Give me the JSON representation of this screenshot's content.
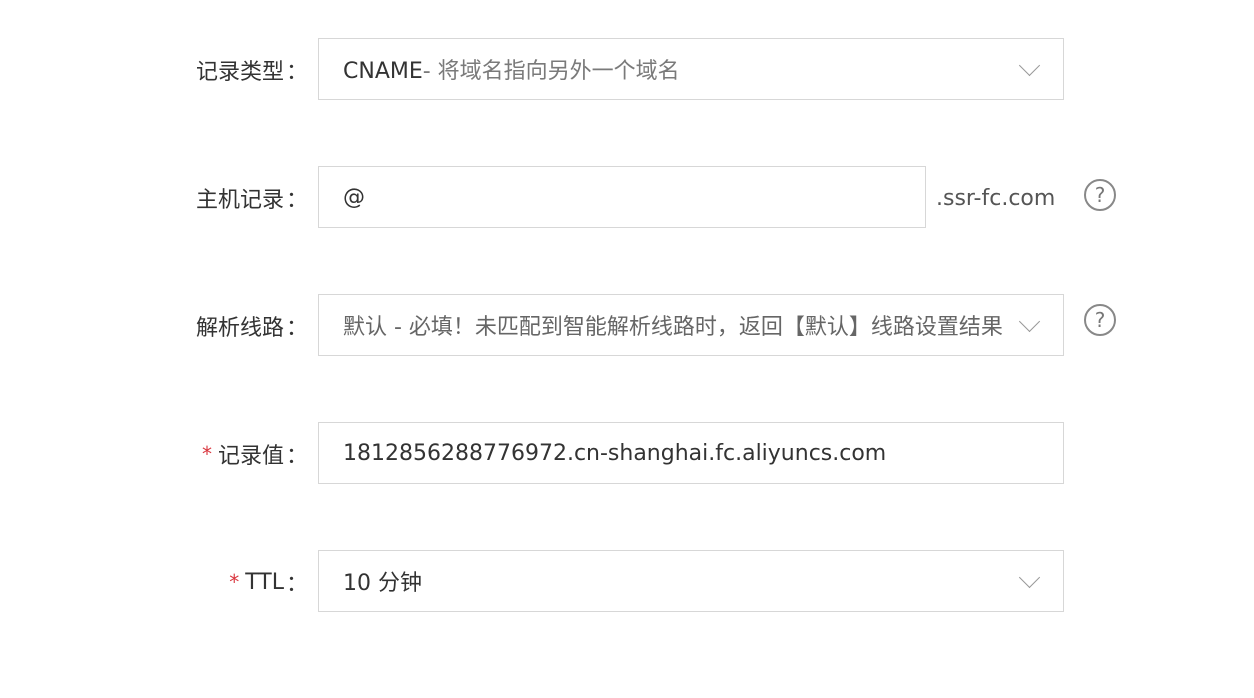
{
  "form": {
    "record_type": {
      "label": "记录类型",
      "value_code": "CNAME",
      "value_desc": "- 将域名指向另外一个域名",
      "icon": "chevron-down-icon"
    },
    "host_record": {
      "label": "主机记录",
      "value": "@",
      "suffix": ".ssr-fc.com",
      "help_icon": "?"
    },
    "resolution_line": {
      "label": "解析线路",
      "value": "默认 - 必填！未匹配到智能解析线路时，返回【默认】线路设置结果",
      "help_icon": "?",
      "icon": "chevron-down-icon"
    },
    "record_value": {
      "label": "记录值",
      "required_mark": "*",
      "value": "1812856288776972.cn-shanghai.fc.aliyuncs.com"
    },
    "ttl": {
      "label": "TTL",
      "required_mark": "*",
      "value": "10 分钟",
      "icon": "chevron-down-icon"
    },
    "colon": "："
  }
}
